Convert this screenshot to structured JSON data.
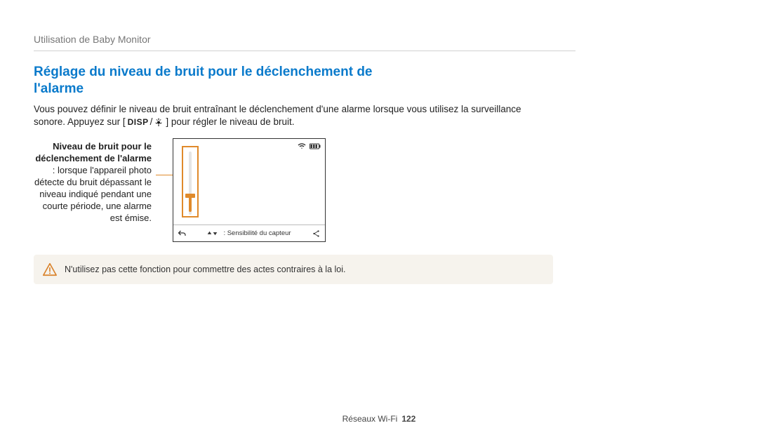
{
  "breadcrumb": "Utilisation de Baby Monitor",
  "heading": "Réglage du niveau de bruit pour le déclenchement de l'alarme",
  "body_pre": "Vous pouvez définir le niveau de bruit entraînant le déclenchement d'une alarme lorsque vous utilisez la surveillance sonore. Appuyez sur [",
  "disp_label": "DISP",
  "body_post": "] pour régler le niveau de bruit.",
  "callout": {
    "title": "Niveau de bruit pour le déclenchement de l'alarme",
    "sep": " : ",
    "desc": "lorsque l'appareil photo détecte du bruit dépassant le niveau indiqué pendant une courte période, une alarme est émise."
  },
  "device_bottom_label": ": Sensibilité du capteur",
  "warning_text": "N'utilisez pas cette fonction pour commettre des actes contraires à la loi.",
  "footer_label": "Réseaux Wi-Fi",
  "page_number": "122"
}
